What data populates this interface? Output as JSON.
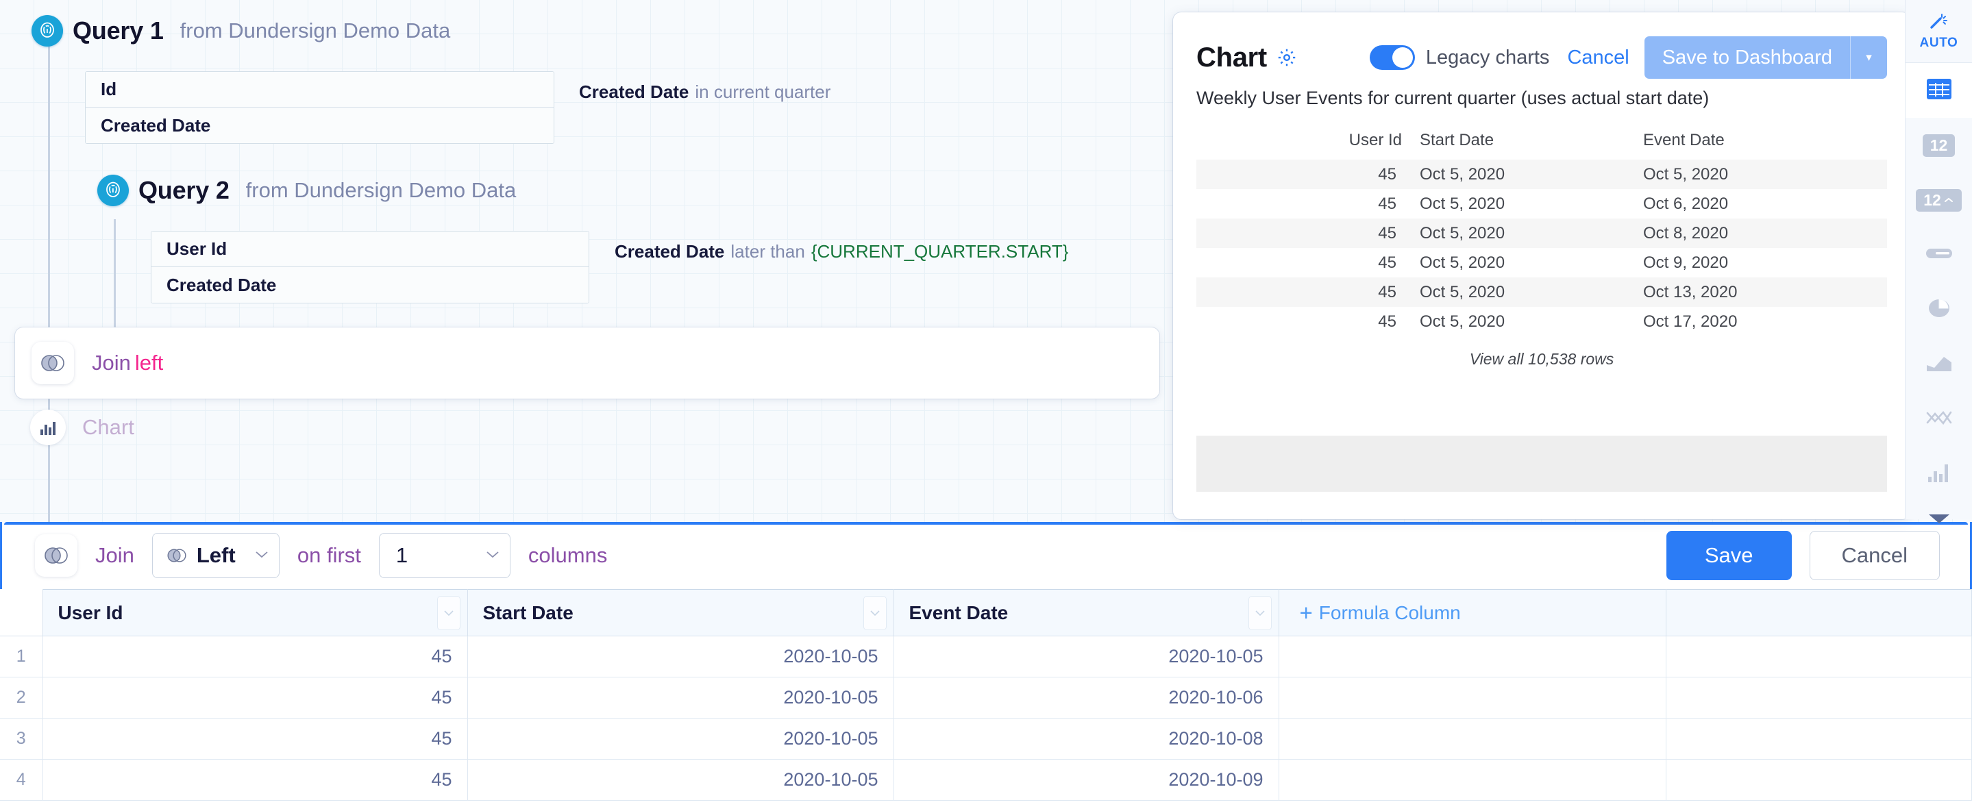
{
  "canvas": {
    "queries": [
      {
        "title": "Query 1",
        "source_prefix": "from",
        "source": "Dundersign Demo Data",
        "fields": [
          "Id",
          "Created Date"
        ],
        "filter": {
          "field": "Created Date",
          "operator": "in current quarter",
          "value": ""
        }
      },
      {
        "title": "Query 2",
        "source_prefix": "from",
        "source": "Dundersign Demo Data",
        "fields": [
          "User Id",
          "Created Date"
        ],
        "filter": {
          "field": "Created Date",
          "operator": "later than",
          "value": "{CURRENT_QUARTER.START}"
        }
      }
    ],
    "join_card": {
      "label": "Join",
      "mode": "left"
    },
    "chart_node": {
      "label": "Chart"
    }
  },
  "chart_panel": {
    "title": "Chart",
    "gear_icon": "gear-icon",
    "legacy_toggle": {
      "label": "Legacy charts",
      "on": true
    },
    "cancel_label": "Cancel",
    "save_label": "Save to Dashboard",
    "subtitle": "Weekly User Events for current quarter (uses actual start date)",
    "columns": [
      "User Id",
      "Start Date",
      "Event Date"
    ],
    "rows": [
      [
        "45",
        "Oct 5, 2020",
        "Oct 5, 2020"
      ],
      [
        "45",
        "Oct 5, 2020",
        "Oct 6, 2020"
      ],
      [
        "45",
        "Oct 5, 2020",
        "Oct 8, 2020"
      ],
      [
        "45",
        "Oct 5, 2020",
        "Oct 9, 2020"
      ],
      [
        "45",
        "Oct 5, 2020",
        "Oct 13, 2020"
      ],
      [
        "45",
        "Oct 5, 2020",
        "Oct 17, 2020"
      ]
    ],
    "view_all": "View all 10,538 rows"
  },
  "rail": {
    "items": [
      {
        "name": "auto",
        "label": "AUTO",
        "icon": "magic-wand-icon",
        "active": false
      },
      {
        "name": "table",
        "label": "",
        "icon": "table-icon",
        "active": true
      },
      {
        "name": "number",
        "label": "12",
        "icon": "number-icon",
        "active": false
      },
      {
        "name": "trend",
        "label": "12",
        "icon": "number-trend-icon",
        "active": false
      },
      {
        "name": "progress",
        "label": "",
        "icon": "progress-bar-icon",
        "active": false
      },
      {
        "name": "pie",
        "label": "",
        "icon": "pie-chart-icon",
        "active": false
      },
      {
        "name": "area",
        "label": "",
        "icon": "area-chart-icon",
        "active": false
      },
      {
        "name": "line",
        "label": "",
        "icon": "line-chart-icon",
        "active": false
      },
      {
        "name": "bar",
        "label": "",
        "icon": "bar-chart-icon",
        "active": false
      },
      {
        "name": "more",
        "label": "",
        "icon": "chevron-down-icon",
        "active": false
      }
    ]
  },
  "join_editor": {
    "join_word": "Join",
    "type_value": "Left",
    "on_first_label": "on first",
    "columns_value": "1",
    "columns_label": "columns",
    "save_label": "Save",
    "cancel_label": "Cancel"
  },
  "grid": {
    "columns": [
      "User Id",
      "Start Date",
      "Event Date"
    ],
    "formula_column_label": "Formula Column",
    "formula_plus": "+",
    "rows": [
      {
        "n": "1",
        "cells": [
          "45",
          "2020-10-05",
          "2020-10-05"
        ]
      },
      {
        "n": "2",
        "cells": [
          "45",
          "2020-10-05",
          "2020-10-06"
        ]
      },
      {
        "n": "3",
        "cells": [
          "45",
          "2020-10-05",
          "2020-10-08"
        ]
      },
      {
        "n": "4",
        "cells": [
          "45",
          "2020-10-05",
          "2020-10-09"
        ]
      }
    ]
  },
  "colors": {
    "accent": "#2b7cf6",
    "db_badge": "#1aa3d8",
    "join_purple": "#8b4fa8",
    "join_pink": "#f4248d",
    "template_green": "#16773b"
  }
}
